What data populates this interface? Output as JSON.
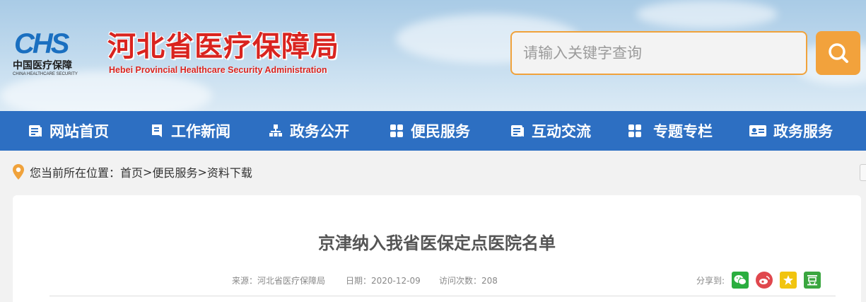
{
  "header": {
    "logo_text": "CHS",
    "logo_subtitle_cn": "中国医疗保障",
    "logo_subtitle_en": "CHINA HEALTHCARE SECURITY",
    "site_title": "河北省医疗保障局",
    "site_title_en": "Hebei Provincial Healthcare Security Administration",
    "search_placeholder": "请输入关键字查询",
    "search_icon": "magnifier-icon"
  },
  "nav": {
    "items": [
      {
        "label": "网站首页",
        "icon": "list-icon"
      },
      {
        "label": "工作新闻",
        "icon": "bookmark-icon"
      },
      {
        "label": "政务公开",
        "icon": "org-chart-icon"
      },
      {
        "label": "便民服务",
        "icon": "grid-icon"
      },
      {
        "label": "互动交流",
        "icon": "list-icon"
      },
      {
        "label": "专题专栏",
        "icon": "grid-icon"
      },
      {
        "label": "政务服务",
        "icon": "id-card-icon"
      }
    ]
  },
  "breadcrumb": {
    "prefix": "您当前所在位置：",
    "path": [
      {
        "label": "首页"
      },
      {
        "label": "便民服务"
      },
      {
        "label": "资料下载"
      }
    ],
    "separator": ">"
  },
  "article": {
    "title": "京津纳入我省医保定点医院名单",
    "source_label": "来源：",
    "source": "河北省医疗保障局",
    "date_label": "日期：",
    "date": "2020-12-09",
    "visits_label": "访问次数：",
    "visits": "208",
    "share_label": "分享到:",
    "share_targets": [
      "wechat-icon",
      "weibo-icon",
      "qzone-icon",
      "douban-icon"
    ]
  },
  "colors": {
    "nav_bg": "#2d6fc2",
    "accent_orange": "#f2a23c",
    "title_red": "#d9241f",
    "logo_blue": "#1a6fc0"
  }
}
